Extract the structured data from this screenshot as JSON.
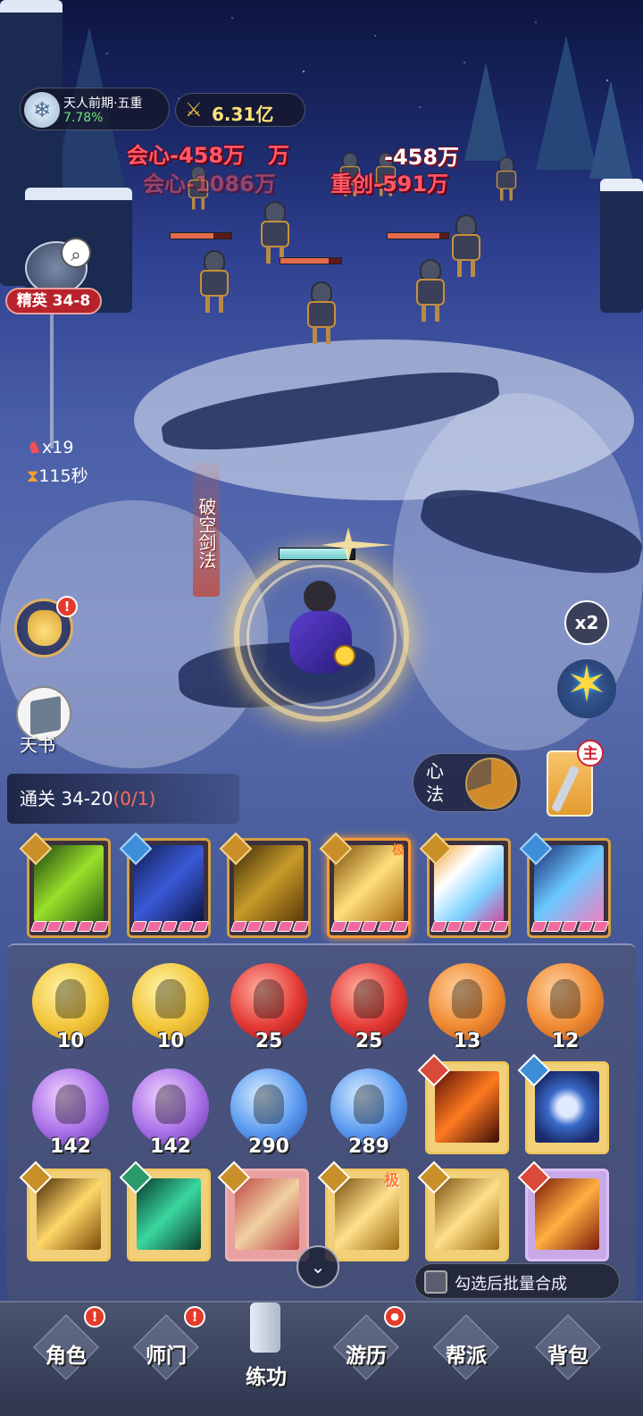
{
  "hud": {
    "realm_name": "天人前期·五重",
    "realm_progress": "7.78%",
    "power": "6.31亿",
    "stage": "精英 34-8",
    "kills": "x19",
    "timer": "115秒",
    "skill_name": "破空剑法",
    "speed": "x2",
    "xinfa": "心法",
    "weapon_badge": "主",
    "tianshu": "天书",
    "mission_text": "通关 34-20",
    "mission_progress": "(0/1)"
  },
  "damage_numbers": [
    "会心-458万",
    "万",
    "-458万",
    "会心-1086万",
    "重创-591万"
  ],
  "orbs": [
    {
      "value": "10",
      "color": "yellow"
    },
    {
      "value": "10",
      "color": "yellow"
    },
    {
      "value": "25",
      "color": "red"
    },
    {
      "value": "25",
      "color": "red"
    },
    {
      "value": "13",
      "color": "orange"
    },
    {
      "value": "12",
      "color": "orange"
    },
    {
      "value": "142",
      "color": "purple"
    },
    {
      "value": "142",
      "color": "purple"
    },
    {
      "value": "290",
      "color": "blue"
    },
    {
      "value": "289",
      "color": "blue"
    }
  ],
  "equipped_skills": [
    {
      "icon": "sword-tag-icon",
      "art": "green"
    },
    {
      "icon": "yinyang-tag-icon",
      "art": "blue"
    },
    {
      "icon": "sword-tag-icon",
      "art": "gold"
    },
    {
      "icon": "sword-tag-icon",
      "art": "gold",
      "badge": "极"
    },
    {
      "icon": "sword-tag-icon",
      "art": "rainbow"
    },
    {
      "icon": "yinyang-tag-icon",
      "art": "cyan"
    }
  ],
  "grade_mark": "极",
  "batch_label": "勾选后批量合成",
  "nav": [
    {
      "label": "角色",
      "badge": "!"
    },
    {
      "label": "师门",
      "badge": "!"
    },
    {
      "label": "练功",
      "active": true
    },
    {
      "label": "游历",
      "badge": "●"
    },
    {
      "label": "帮派"
    },
    {
      "label": "背包"
    }
  ],
  "colors": {
    "accent": "#f0c860",
    "stage_red": "#b8232b",
    "progress_green": "#6fe67a"
  }
}
